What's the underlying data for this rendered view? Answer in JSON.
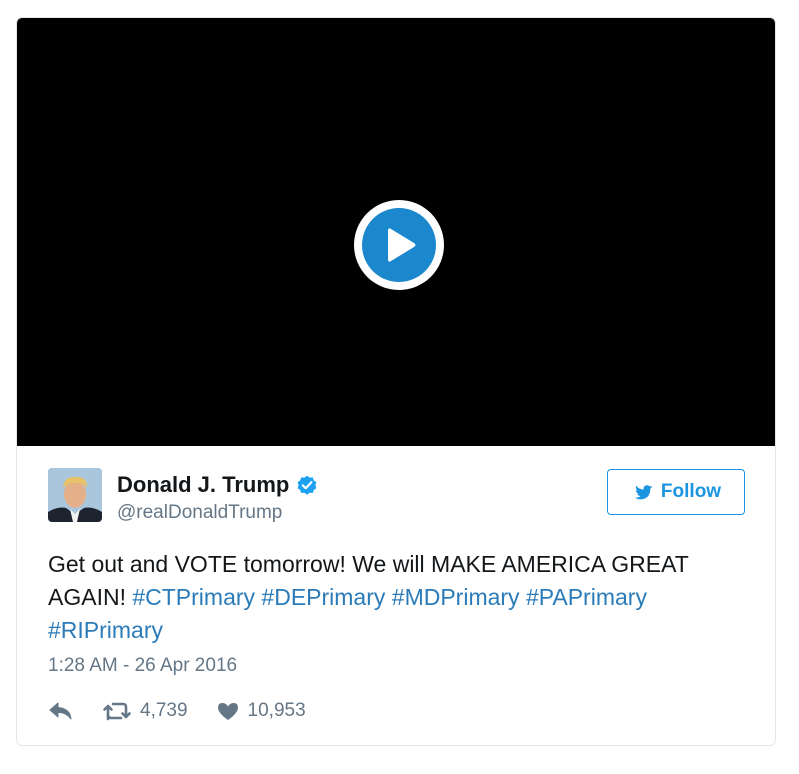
{
  "tweet": {
    "author": {
      "display_name": "Donald J. Trump",
      "handle": "@realDonaldTrump",
      "verified": true
    },
    "follow_label": "Follow",
    "text_plain": "Get out and VOTE tomorrow! We will MAKE AMERICA GREAT AGAIN! ",
    "hashtags": [
      "#CTPrimary",
      "#DEPrimary",
      "#MDPrimary",
      "#PAPrimary",
      "#RIPrimary"
    ],
    "timestamp": "1:28 AM - 26 Apr 2016",
    "retweet_count": "4,739",
    "like_count": "10,953"
  },
  "colors": {
    "link": "#2b7bb9",
    "follow": "#1b95e0",
    "play_button": "#1b87cc",
    "muted": "#657786",
    "video_bg": "#000000"
  },
  "icons": {
    "play": "play-icon",
    "verified": "verified-badge-icon",
    "follow_bird": "twitter-bird-icon",
    "reply": "reply-icon",
    "retweet": "retweet-icon",
    "like": "heart-icon"
  }
}
